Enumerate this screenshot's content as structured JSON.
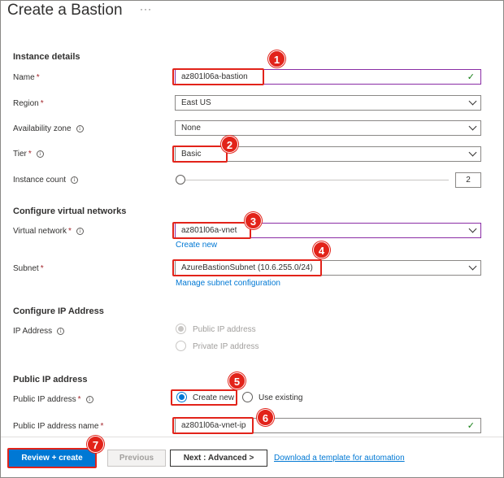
{
  "header": {
    "title": "Create a Bastion",
    "more": "···"
  },
  "sections": {
    "instance": "Instance details",
    "vnet": "Configure virtual networks",
    "ip": "Configure IP Address",
    "pip": "Public IP address"
  },
  "fields": {
    "name": {
      "label": "Name",
      "value": "az801l06a-bastion"
    },
    "region": {
      "label": "Region",
      "value": "East US"
    },
    "zone": {
      "label": "Availability zone",
      "value": "None"
    },
    "tier": {
      "label": "Tier",
      "value": "Basic"
    },
    "count": {
      "label": "Instance count",
      "value": "2"
    },
    "vnet": {
      "label": "Virtual network",
      "value": "az801l06a-vnet",
      "link": "Create new"
    },
    "subnet": {
      "label": "Subnet",
      "value": "AzureBastionSubnet (10.6.255.0/24)",
      "link": "Manage subnet configuration"
    },
    "ip": {
      "label": "IP Address",
      "option1": "Public IP address",
      "option2": "Private IP address"
    },
    "pip": {
      "label": "Public IP address",
      "option1": "Create new",
      "option2": "Use existing"
    },
    "pipname": {
      "label": "Public IP address name",
      "value": "az801l06a-vnet-ip"
    }
  },
  "required_mark": "*",
  "info_glyph": "i",
  "check_glyph": "✓",
  "badges": [
    "1",
    "2",
    "3",
    "4",
    "5",
    "6",
    "7"
  ],
  "footer": {
    "review": "Review + create",
    "previous": "Previous",
    "next": "Next : Advanced >",
    "download": "Download a template for automation"
  },
  "colors": {
    "accent": "#0078d4",
    "highlight": "#e2231a",
    "valid": "#107c10",
    "focus": "#8a2da5"
  }
}
